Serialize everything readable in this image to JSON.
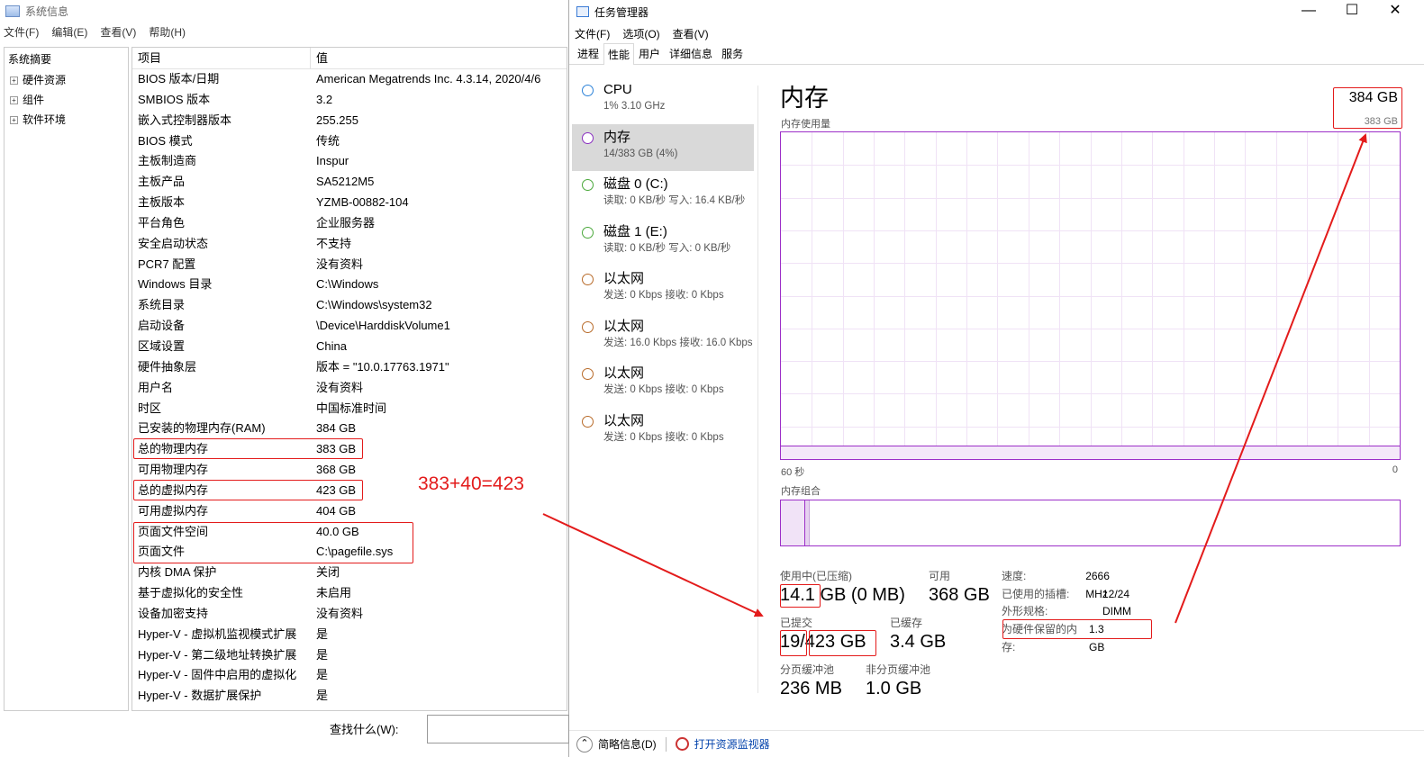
{
  "sysinfo": {
    "title": "系统信息",
    "menu": [
      "文件(F)",
      "编辑(E)",
      "查看(V)",
      "帮助(H)"
    ],
    "tree": {
      "root": "系统摘要",
      "children": [
        "硬件资源",
        "组件",
        "软件环境"
      ]
    },
    "columns": [
      "项目",
      "值"
    ],
    "rows": [
      [
        "BIOS 版本/日期",
        "American Megatrends Inc. 4.3.14, 2020/4/6"
      ],
      [
        "SMBIOS 版本",
        "3.2"
      ],
      [
        "嵌入式控制器版本",
        "255.255"
      ],
      [
        "BIOS 模式",
        "传统"
      ],
      [
        "主板制造商",
        "Inspur"
      ],
      [
        "主板产品",
        "SA5212M5"
      ],
      [
        "主板版本",
        "YZMB-00882-104"
      ],
      [
        "平台角色",
        "企业服务器"
      ],
      [
        "安全启动状态",
        "不支持"
      ],
      [
        "PCR7 配置",
        "没有资料"
      ],
      [
        "Windows 目录",
        "C:\\Windows"
      ],
      [
        "系统目录",
        "C:\\Windows\\system32"
      ],
      [
        "启动设备",
        "\\Device\\HarddiskVolume1"
      ],
      [
        "区域设置",
        "China"
      ],
      [
        "硬件抽象层",
        "版本 = \"10.0.17763.1971\""
      ],
      [
        "用户名",
        "没有资料"
      ],
      [
        "时区",
        "中国标准时间"
      ],
      [
        "已安装的物理内存(RAM)",
        "384 GB"
      ],
      [
        "总的物理内存",
        "383 GB"
      ],
      [
        "可用物理内存",
        "368 GB"
      ],
      [
        "总的虚拟内存",
        "423 GB"
      ],
      [
        "可用虚拟内存",
        "404 GB"
      ],
      [
        "页面文件空间",
        "40.0 GB"
      ],
      [
        "页面文件",
        "C:\\pagefile.sys"
      ],
      [
        "内核 DMA 保护",
        "关闭"
      ],
      [
        "基于虚拟化的安全性",
        "未启用"
      ],
      [
        "设备加密支持",
        "没有资料"
      ],
      [
        "Hyper-V - 虚拟机监视模式扩展",
        "是"
      ],
      [
        "Hyper-V - 第二级地址转换扩展",
        "是"
      ],
      [
        "Hyper-V - 固件中启用的虚拟化",
        "是"
      ],
      [
        "Hyper-V - 数据扩展保护",
        "是"
      ]
    ],
    "find_label": "查找什么(W):"
  },
  "taskmgr": {
    "title": "任务管理器",
    "menu": [
      "文件(F)",
      "选项(O)",
      "查看(V)"
    ],
    "tabs": [
      "进程",
      "性能",
      "用户",
      "详细信息",
      "服务"
    ],
    "active_tab": 1,
    "resources": [
      {
        "name": "CPU",
        "sub": "1% 3.10 GHz",
        "color": "#2c82d8"
      },
      {
        "name": "内存",
        "sub": "14/383 GB (4%)",
        "color": "#8a2fc0"
      },
      {
        "name": "磁盘 0 (C:)",
        "sub": "读取: 0 KB/秒 写入: 16.4 KB/秒",
        "color": "#4aa83b"
      },
      {
        "name": "磁盘 1 (E:)",
        "sub": "读取: 0 KB/秒 写入: 0 KB/秒",
        "color": "#4aa83b"
      },
      {
        "name": "以太网",
        "sub": "发送: 0 Kbps 接收: 0 Kbps",
        "color": "#b86b2a"
      },
      {
        "name": "以太网",
        "sub": "发送: 16.0 Kbps 接收: 16.0 Kbps",
        "color": "#b86b2a"
      },
      {
        "name": "以太网",
        "sub": "发送: 0 Kbps 接收: 0 Kbps",
        "color": "#b86b2a"
      },
      {
        "name": "以太网",
        "sub": "发送: 0 Kbps 接收: 0 Kbps",
        "color": "#b86b2a"
      }
    ],
    "active_resource": 1,
    "memory": {
      "title": "内存",
      "total_big": "384 GB",
      "usage_label": "内存使用量",
      "total_small": "383 GB",
      "usage_fraction": 0.04,
      "axis_left": "60 秒",
      "axis_right": "0",
      "composition_label": "内存组合",
      "composition_used_fraction": 0.04,
      "composition_modified_fraction": 0.006,
      "in_use_label": "使用中(已压缩)",
      "in_use_value": "14.1 GB (0 MB)",
      "available_label": "可用",
      "available_value": "368 GB",
      "committed_label": "已提交",
      "committed_value": "19/423 GB",
      "cached_label": "已缓存",
      "cached_value": "3.4 GB",
      "paged_label": "分页缓冲池",
      "paged_value": "236 MB",
      "nonpaged_label": "非分页缓冲池",
      "nonpaged_value": "1.0 GB",
      "details": [
        [
          "速度:",
          "2666 MHz"
        ],
        [
          "已使用的插槽:",
          "12/24"
        ],
        [
          "外形规格:",
          "DIMM"
        ],
        [
          "为硬件保留的内存:",
          "1.3 GB"
        ]
      ]
    },
    "footer": {
      "summary": "简略信息(D)",
      "monitor_link": "打开资源监视器"
    }
  },
  "annotation": {
    "formula": "383+40=423",
    "color": "#e31b1b"
  }
}
